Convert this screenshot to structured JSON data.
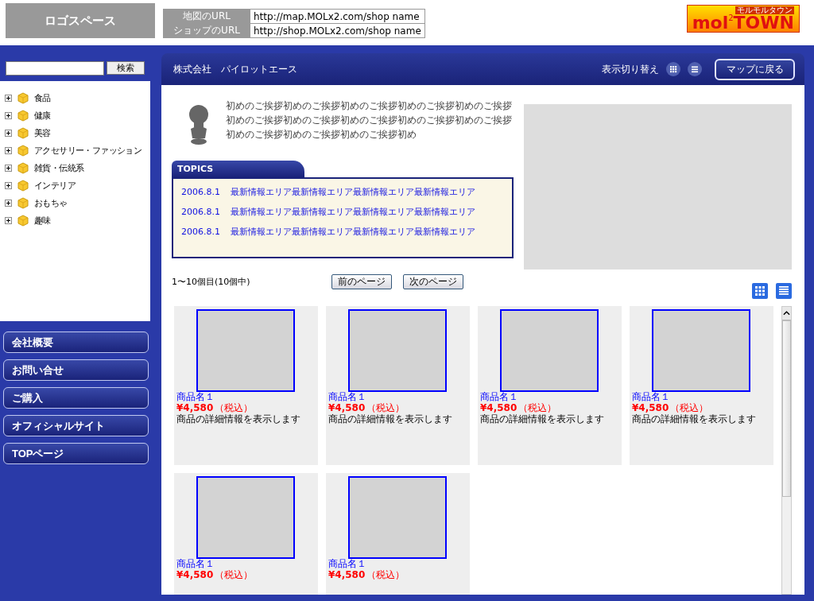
{
  "header": {
    "logo_space": "ロゴスペース",
    "urls": [
      {
        "label": "地図のURL",
        "value": "http://map.MOLx2.com/shop name"
      },
      {
        "label": "ショップのURL",
        "value": "http://shop.MOLx2.com/shop name"
      }
    ],
    "brand_logo": {
      "text": "mol",
      "sup": "2",
      "text2": "TOWN",
      "tagline": "モルモルタウン"
    }
  },
  "sidebar": {
    "search": {
      "button": "検索"
    },
    "categories": [
      {
        "label": "食品",
        "expanded": false
      },
      {
        "label": "健康",
        "expanded": false
      },
      {
        "label": "美容",
        "expanded": false
      },
      {
        "label": "アクセサリー・ファッション",
        "expanded": false
      },
      {
        "label": "雑貨・伝統系",
        "expanded": false
      },
      {
        "label": "インテリア",
        "expanded": false
      },
      {
        "label": "おもちゃ",
        "expanded": false
      },
      {
        "label": "趣味",
        "expanded": false
      }
    ],
    "menu": [
      "会社概要",
      "お問い合せ",
      "ご購入",
      "オフィシャルサイト",
      "TOPページ"
    ]
  },
  "main": {
    "company": "株式会社　パイロットエース",
    "view_toggle_label": "表示切り替え",
    "back_button": "マップに戻る",
    "greeting": "初めのご挨拶初めのご挨拶初めのご挨拶初めのご挨拶初めのご挨拶初めのご挨拶初めのご挨拶初めのご挨拶初めのご挨拶初めのご挨拶初めのご挨拶初めのご挨拶初めのご挨拶初め",
    "topics": {
      "title": "TOPICS",
      "items": [
        {
          "date": "2006.8.1",
          "text": "最新情報エリア最新情報エリア最新情報エリア最新情報エリア"
        },
        {
          "date": "2006.8.1",
          "text": "最新情報エリア最新情報エリア最新情報エリア最新情報エリア"
        },
        {
          "date": "2006.8.1",
          "text": "最新情報エリア最新情報エリア最新情報エリア最新情報エリア"
        }
      ]
    },
    "count": "1〜10個目(10個中)",
    "prev": "前のページ",
    "next": "次のページ",
    "products": [
      {
        "name": "商品名１",
        "price": "¥4,580",
        "tax": "（税込）",
        "desc": "商品の詳細情報を表示します"
      },
      {
        "name": "商品名１",
        "price": "¥4,580",
        "tax": "（税込）",
        "desc": "商品の詳細情報を表示します"
      },
      {
        "name": "商品名１",
        "price": "¥4,580",
        "tax": "（税込）",
        "desc": "商品の詳細情報を表示します"
      },
      {
        "name": "商品名１",
        "price": "¥4,580",
        "tax": "（税込）",
        "desc": "商品の詳細情報を表示します"
      },
      {
        "name": "商品名１",
        "price": "¥4,580",
        "tax": "（税込）"
      },
      {
        "name": "商品名１",
        "price": "¥4,580",
        "tax": "（税込）"
      }
    ]
  }
}
